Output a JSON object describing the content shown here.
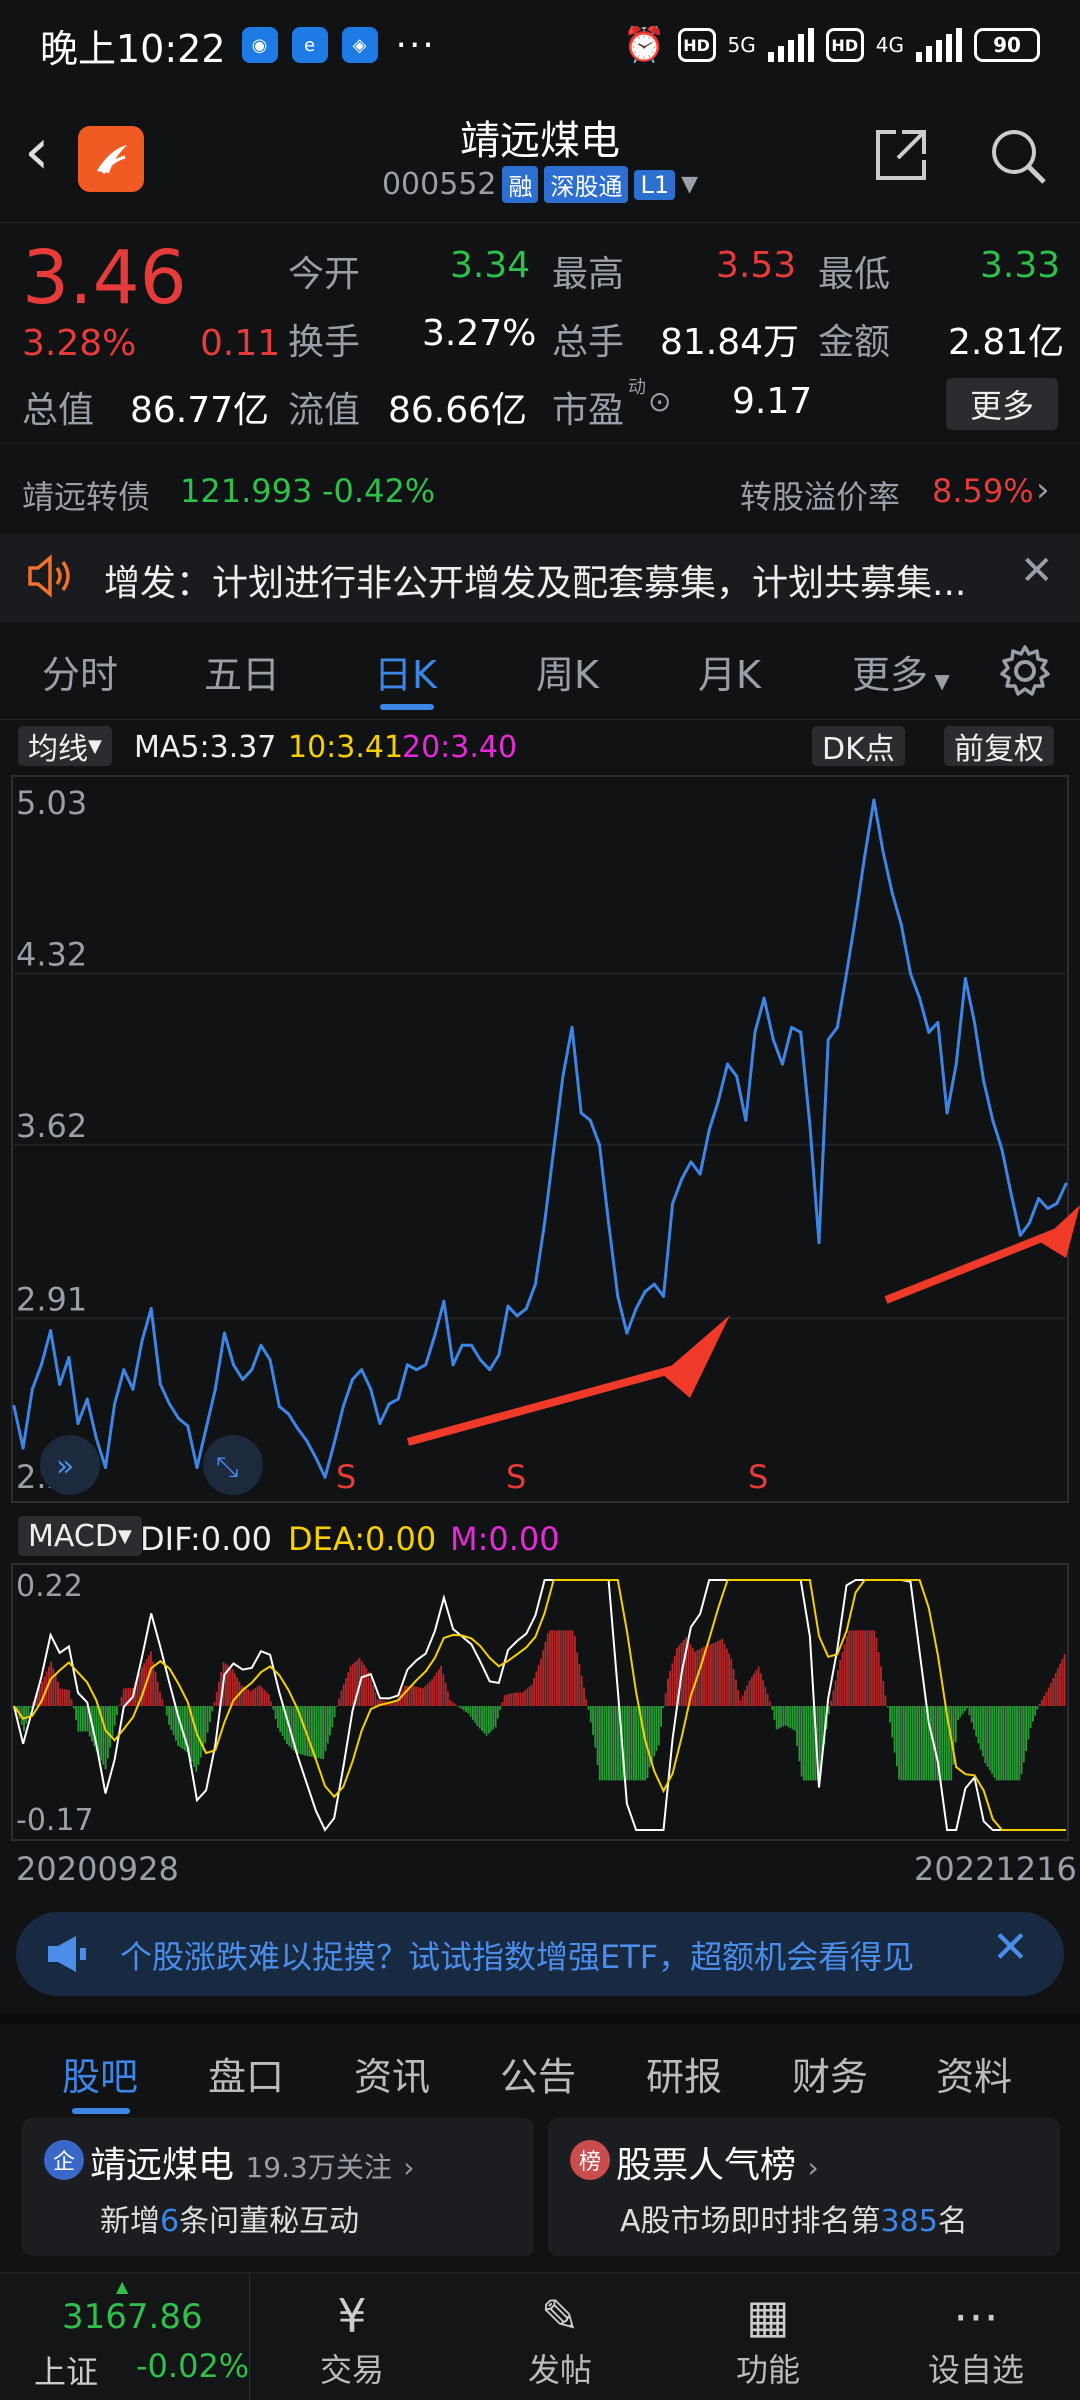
{
  "status": {
    "time": "晚上10:22",
    "net1": "5G",
    "net2": "4G",
    "hd": "HD",
    "battery": "90"
  },
  "header": {
    "title": "靖远煤电",
    "code": "000552",
    "tags": [
      "融",
      "深股通",
      "L1"
    ]
  },
  "quote": {
    "price": "3.46",
    "pct": "3.28%",
    "change": "0.11",
    "rows": [
      [
        {
          "label": "今开",
          "value": "3.34",
          "color": "grn"
        },
        {
          "label": "最高",
          "value": "3.53",
          "color": "red"
        },
        {
          "label": "最低",
          "value": "3.33",
          "color": "grn"
        }
      ],
      [
        {
          "label": "换手",
          "value": "3.27%",
          "color": "wht"
        },
        {
          "label": "总手",
          "value": "81.84万",
          "color": "wht"
        },
        {
          "label": "金额",
          "value": "2.81亿",
          "color": "wht"
        }
      ],
      [
        {
          "label": "总值",
          "value": "86.77亿",
          "color": "wht"
        },
        {
          "label": "流值",
          "value": "86.66亿",
          "color": "wht"
        },
        {
          "label": "市盈",
          "value": "9.17",
          "color": "wht"
        }
      ]
    ],
    "pe_note": "动",
    "more_btn": "更多",
    "convertible": {
      "name": "靖远转债",
      "price": "121.993",
      "pct": "-0.42%",
      "premium_label": "转股溢价率",
      "premium": "8.59%"
    }
  },
  "notice": {
    "text": "增发：计划进行非公开增发及配套募集，计划共募集..."
  },
  "tabs": {
    "items": [
      "分时",
      "五日",
      "日K",
      "周K",
      "月K",
      "更多"
    ],
    "active": 2
  },
  "chart_bar": {
    "ma_btn": "均线",
    "ma5": "MA5:3.37",
    "ma10": "10:3.41",
    "ma20": "20:3.40",
    "dk_btn": "DK点",
    "adj_btn": "前复权"
  },
  "macd_bar": {
    "btn": "MACD",
    "dif": "DIF:0.00",
    "dea": "DEA:0.00",
    "m": "M:0.00"
  },
  "dates": {
    "start": "20200928",
    "end": "20221216"
  },
  "colors": {
    "line": "#3d86e6",
    "up": "#e63b3b",
    "down": "#2fbf4a",
    "yellow": "#f5d000",
    "magenta": "#e52bd6",
    "arrow": "#ef3a2a"
  },
  "chart_data": {
    "type": "line",
    "ylim": [
      2.2,
      5.03
    ],
    "yticks": [
      "5.03",
      "4.32",
      "3.62",
      "2.91",
      "2.20"
    ],
    "x_start": "20200928",
    "x_end": "20221216",
    "series": [
      {
        "values": [
          2.55,
          2.38,
          2.62,
          2.72,
          2.86,
          2.64,
          2.75,
          2.48,
          2.58,
          2.42,
          2.3,
          2.56,
          2.7,
          2.62,
          2.82,
          2.95,
          2.64,
          2.56,
          2.5,
          2.47,
          2.3,
          2.46,
          2.62,
          2.85,
          2.72,
          2.66,
          2.7,
          2.8,
          2.74,
          2.55,
          2.52,
          2.46,
          2.41,
          2.34,
          2.26,
          2.4,
          2.55,
          2.66,
          2.7,
          2.62,
          2.48,
          2.56,
          2.58,
          2.72,
          2.7,
          2.72,
          2.84,
          2.98,
          2.72,
          2.8,
          2.8,
          2.74,
          2.7,
          2.76,
          2.96,
          2.92,
          2.95,
          3.05,
          3.3,
          3.6,
          3.9,
          4.1,
          3.75,
          3.72,
          3.62,
          3.3,
          3.0,
          2.85,
          2.95,
          3.02,
          3.05,
          3.0,
          3.38,
          3.48,
          3.55,
          3.5,
          3.68,
          3.8,
          3.95,
          3.9,
          3.72,
          4.08,
          4.22,
          4.05,
          3.95,
          4.1,
          4.08,
          3.7,
          3.22,
          4.05,
          4.1,
          4.32,
          4.55,
          4.8,
          5.03,
          4.82,
          4.65,
          4.52,
          4.32,
          4.22,
          4.08,
          4.12,
          3.75,
          3.95,
          4.3,
          4.12,
          3.88,
          3.72,
          3.6,
          3.42,
          3.25,
          3.3,
          3.4,
          3.36,
          3.38,
          3.46
        ]
      }
    ]
  },
  "macd_data": {
    "ylim": [
      -0.17,
      0.22
    ],
    "labels": [
      "0.22",
      "-0.17"
    ]
  },
  "signals": [
    "S",
    "S",
    "S"
  ],
  "banner": {
    "text": "个股涨跌难以捉摸？试试指数增强ETF，超额机会看得见"
  },
  "section_tabs": {
    "items": [
      "股吧",
      "盘口",
      "资讯",
      "公告",
      "研报",
      "财务",
      "资料"
    ],
    "active": 0
  },
  "cards": [
    {
      "title": "靖远煤电",
      "sub": "19.3万关注",
      "line_a": "新增",
      "num": "6",
      "line_b": "条问董秘互动",
      "icon": "企"
    },
    {
      "title": "股票人气榜",
      "sub": "",
      "line_a": "A股市场即时排名第",
      "num": "385",
      "line_b": "名",
      "icon": "榜"
    }
  ],
  "bottom": {
    "index_value": "3167.86",
    "index_name": "上证",
    "index_pct": "-0.02%",
    "items": [
      "交易",
      "发帖",
      "功能",
      "设自选"
    ]
  }
}
